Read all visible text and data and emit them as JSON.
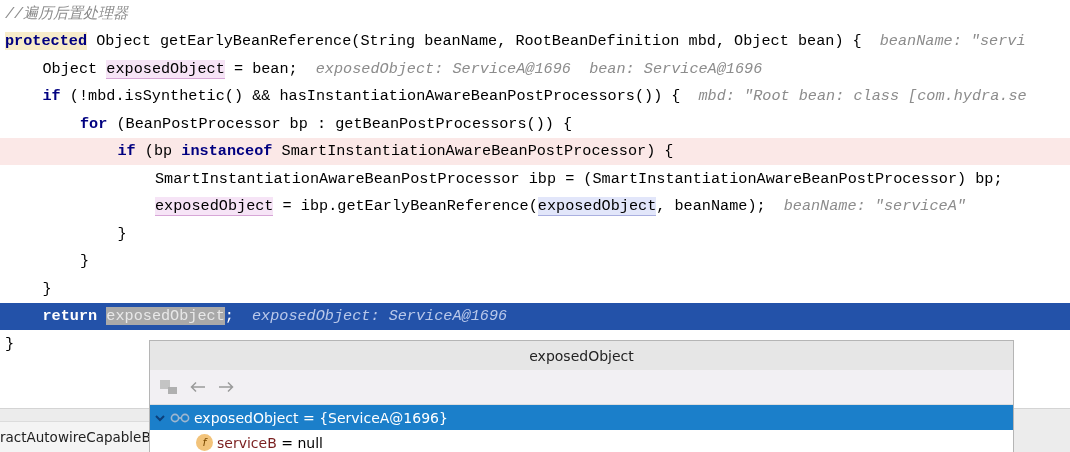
{
  "editor": {
    "lines": [
      {
        "kind": "plain",
        "tokens": [
          {
            "kind": "comment",
            "text": "//遍历后置处理器"
          }
        ]
      },
      {
        "kind": "plain",
        "tokens": [
          {
            "kind": "markedkeyword",
            "text": "protected"
          },
          {
            "kind": "text",
            "text": " Object getEarlyBeanReference(String beanName, RootBeanDefinition mbd, Object bean) {"
          }
        ],
        "hint": "beanName: \"servi",
        "children": [
          {
            "kind": "plain",
            "tokens": [
              {
                "kind": "text",
                "text": "Object "
              },
              {
                "kind": "varwrite",
                "text": "exposedObject"
              },
              {
                "kind": "text",
                "text": " = bean;"
              }
            ],
            "hint": "exposedObject: ServiceA@1696  bean: ServiceA@1696"
          },
          {
            "kind": "plain",
            "tokens": [
              {
                "kind": "keyword",
                "text": "if"
              },
              {
                "kind": "text",
                "text": " (!mbd.isSynthetic() && hasInstantiationAwareBeanPostProcessors()) {"
              }
            ],
            "hint": "mbd: \"Root bean: class [com.hydra.se",
            "children": [
              {
                "kind": "plain",
                "tokens": [
                  {
                    "kind": "keyword",
                    "text": "for"
                  },
                  {
                    "kind": "text",
                    "text": " (BeanPostProcessor bp : getBeanPostProcessors()) {"
                  }
                ],
                "children": [
                  {
                    "kind": "breakpoint",
                    "tokens": [
                      {
                        "kind": "keyword",
                        "text": "if"
                      },
                      {
                        "kind": "text",
                        "text": " (bp "
                      },
                      {
                        "kind": "keyword",
                        "text": "instanceof"
                      },
                      {
                        "kind": "text",
                        "text": " SmartInstantiationAwareBeanPostProcessor) {"
                      }
                    ],
                    "children": [
                      {
                        "kind": "plain",
                        "tokens": [
                          {
                            "kind": "text",
                            "text": "SmartInstantiationAwareBeanPostProcessor ibp = (SmartInstantiationAwareBeanPostProcessor) bp;"
                          }
                        ]
                      },
                      {
                        "kind": "plain",
                        "tokens": [
                          {
                            "kind": "varwrite",
                            "text": "exposedObject"
                          },
                          {
                            "kind": "text",
                            "text": " = ibp.getEarlyBeanReference("
                          },
                          {
                            "kind": "varread",
                            "text": "exposedObject"
                          },
                          {
                            "kind": "text",
                            "text": ", beanName);"
                          }
                        ],
                        "hint": "beanName: \"serviceA\""
                      }
                    ]
                  },
                  {
                    "kind": "plain",
                    "tokens": [
                      {
                        "kind": "text",
                        "text": "}"
                      }
                    ]
                  }
                ]
              },
              {
                "kind": "plain",
                "tokens": [
                  {
                    "kind": "text",
                    "text": "}"
                  }
                ]
              }
            ]
          },
          {
            "kind": "plain",
            "tokens": [
              {
                "kind": "text",
                "text": "}"
              }
            ]
          },
          {
            "kind": "execution",
            "tokens": [
              {
                "kind": "keyword",
                "text": "return "
              },
              {
                "kind": "selected",
                "text": "exposedObject"
              },
              {
                "kind": "text",
                "text": ";"
              }
            ],
            "hint": "exposedObject: ServiceA@1696"
          }
        ]
      },
      {
        "kind": "plain",
        "tokens": [
          {
            "kind": "text",
            "text": "}"
          }
        ]
      }
    ]
  },
  "tab_strip": {
    "tab": "ractAutowireCapableB"
  },
  "popup": {
    "title": "exposedObject",
    "tree": [
      {
        "kind": "object",
        "name": "exposedObject",
        "value": "= {ServiceA@1696}",
        "selected": true,
        "expanded": true,
        "children": [
          {
            "kind": "field",
            "badge": "f",
            "name": "serviceB",
            "value": "= null",
            "selected": false
          }
        ]
      }
    ]
  }
}
